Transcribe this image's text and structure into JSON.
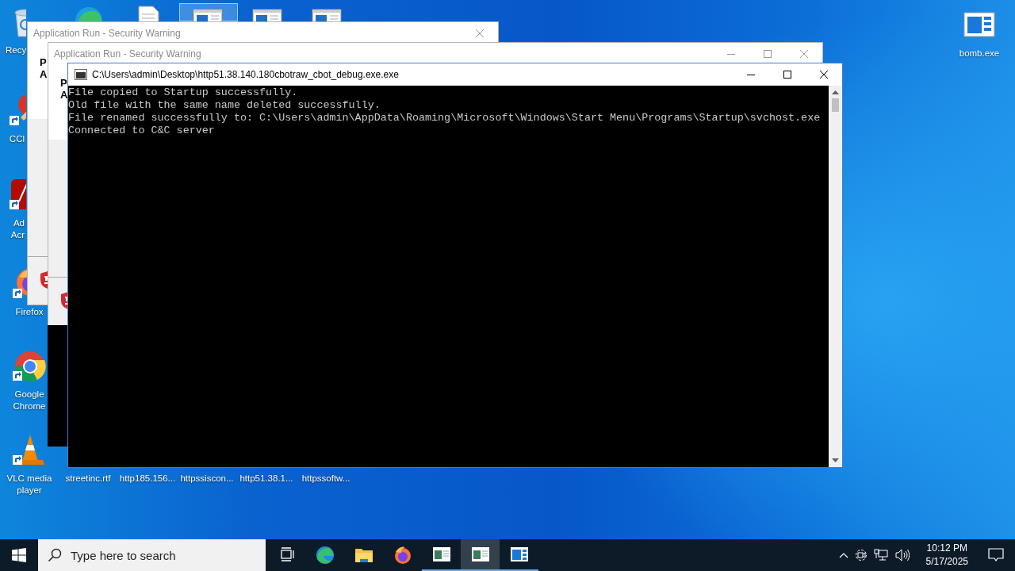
{
  "desktop_icons": [
    {
      "kind": "trash",
      "label": "Recy",
      "selected": false
    },
    {
      "kind": "edge",
      "selected": false
    },
    {
      "kind": "document",
      "selected": false
    },
    {
      "kind": "window",
      "selected": true
    },
    {
      "kind": "window",
      "selected": false
    },
    {
      "kind": "window",
      "selected": false
    },
    {
      "kind": "brush",
      "label": "CCl",
      "selected": false
    },
    {
      "kind": "pdf",
      "label": "Ad Acr",
      "selected": false
    },
    {
      "kind": "firefox",
      "label": "Firefox",
      "selected": false
    },
    {
      "kind": "chrome",
      "label": "Google Chrome",
      "selected": false
    },
    {
      "kind": "cone",
      "label": "VLC media player",
      "selected": false
    },
    {
      "label": "streetinc.rtf",
      "selected": false
    },
    {
      "label": "http185.156...",
      "selected": false
    },
    {
      "label": "httpssiscon...",
      "selected": false
    },
    {
      "label": "http51.38.1...",
      "selected": false
    },
    {
      "label": "httpssoftw...",
      "selected": false
    },
    {
      "kind": "bluewindow",
      "label": "bomb.exe",
      "selected": false
    }
  ],
  "windows": [
    {
      "kind": "dialog",
      "title": "Application Run - Security Warning",
      "active": false,
      "sizable": false,
      "lines": [
        "P",
        "A"
      ]
    },
    {
      "kind": "dialog",
      "title": "Application Run - Security Warning",
      "active": false,
      "sizable": true,
      "lines": [
        "P",
        "A"
      ]
    },
    {
      "kind": "blank"
    },
    {
      "kind": "console",
      "title": "C:\\Users\\admin\\Desktop\\http51.38.140.180cbotraw_cbot_debug.exe.exe",
      "active": true,
      "sizable": true,
      "lines": [
        "File copied to Startup successfully.",
        "Old file with the same name deleted successfully.",
        "File renamed successfully to: C:\\Users\\admin\\AppData\\Roaming\\Microsoft\\Windows\\Start Menu\\Programs\\Startup\\svchost.exe",
        "Connected to C&C server"
      ]
    }
  ],
  "taskbar": {
    "search": {
      "placeholder": "Type here to search"
    },
    "apps": [
      {
        "kind": "taskview",
        "running": false,
        "selected": false
      },
      {
        "kind": "edge",
        "running": false,
        "selected": false
      },
      {
        "kind": "folder",
        "running": false,
        "selected": false
      },
      {
        "kind": "firefox",
        "running": false,
        "selected": false
      },
      {
        "kind": "window",
        "running": true,
        "selected": false
      },
      {
        "kind": "window",
        "running": true,
        "selected": true
      },
      {
        "kind": "bluewindow",
        "running": true,
        "selected": false
      }
    ],
    "clock": {
      "time": "10:12 PM",
      "date": "5/17/2025"
    }
  }
}
